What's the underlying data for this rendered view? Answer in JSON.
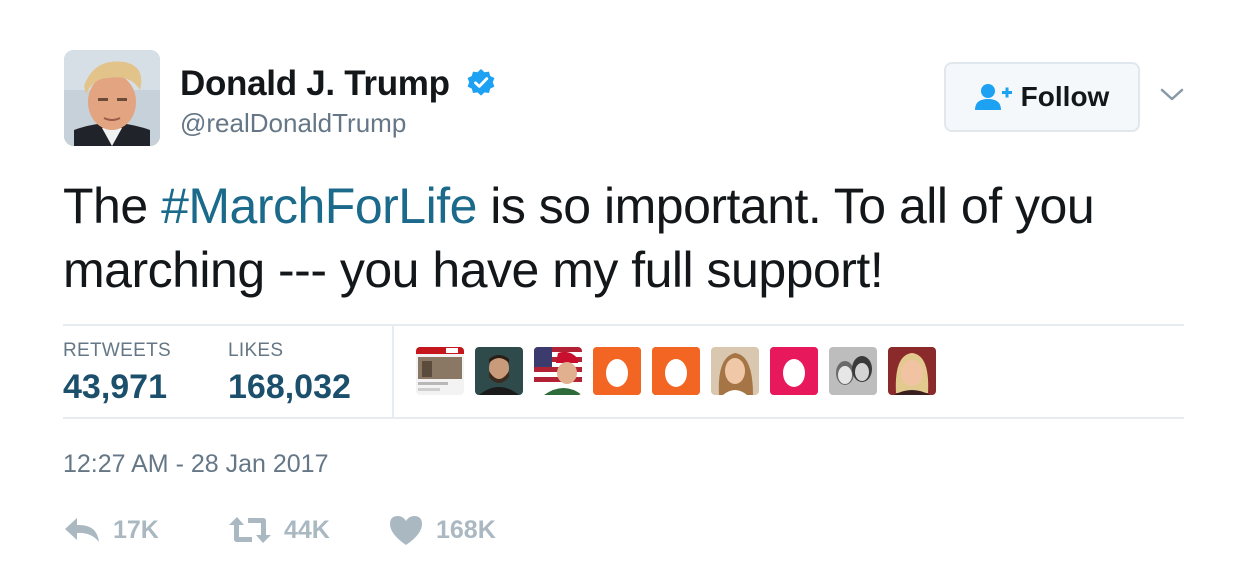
{
  "author": {
    "name": "Donald J. Trump",
    "handle": "@realDonaldTrump",
    "avatar_icon": "profile-photo",
    "verified_icon": "verified-badge-icon",
    "verified_color": "#1da1f2"
  },
  "follow_button": {
    "label": "Follow",
    "icon": "add-user-icon",
    "accent": "#1da1f2"
  },
  "tweet": {
    "text_before": "The ",
    "hashtag": "#MarchForLife",
    "text_after": " is so important. To all of you marching --- you have my full support!",
    "hashtag_color": "#1b6a8b"
  },
  "stats": {
    "retweets_label": "RETWEETS",
    "retweets_value": "43,971",
    "likes_label": "LIKES",
    "likes_value": "168,032"
  },
  "likers": [
    {
      "icon": "news-thumbnail"
    },
    {
      "icon": "bearded-man-photo"
    },
    {
      "icon": "flag-cap-photo"
    },
    {
      "icon": "default-egg-orange"
    },
    {
      "icon": "default-egg-orange"
    },
    {
      "icon": "woman-photo"
    },
    {
      "icon": "default-egg-pink"
    },
    {
      "icon": "bw-couple-photo"
    },
    {
      "icon": "woman-photo-2"
    }
  ],
  "timestamp": "12:27 AM - 28 Jan 2017",
  "actions": {
    "reply": {
      "icon": "reply-icon",
      "count": "17K"
    },
    "retweet": {
      "icon": "retweet-icon",
      "count": "44K"
    },
    "like": {
      "icon": "heart-icon",
      "count": "168K"
    }
  }
}
